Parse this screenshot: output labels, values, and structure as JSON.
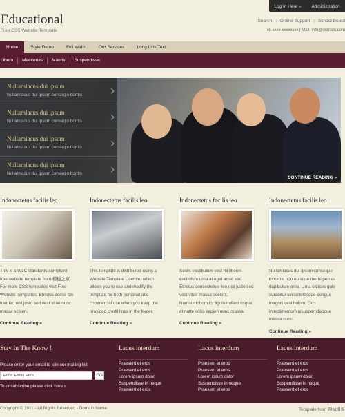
{
  "topbar": {
    "login": "Log In Here »",
    "admin": "Administration"
  },
  "header": {
    "title": "Educational",
    "subtitle": "Free CSS Website Template",
    "links": [
      "Search",
      "Online Support",
      "School Board"
    ],
    "contact": "Tel: xxxx xxxxxxxx | Mail: info@domain.com"
  },
  "nav": {
    "items": [
      "Home",
      "Style Demo",
      "Full Width",
      "Our Services",
      "Long Link Text"
    ]
  },
  "subnav": {
    "items": [
      "Libero",
      "Maecenas",
      "Mauris",
      "Suspendisse"
    ]
  },
  "banner": {
    "slides": [
      {
        "title": "Nullamlacus dui ipsum",
        "text": "Nullamlacus dui ipsum conseqlo borttis"
      },
      {
        "title": "Nullamlacus dui ipsum",
        "text": "Nullamlacus dui ipsum conseqlo borttis"
      },
      {
        "title": "Nullamlacus dui ipsum",
        "text": "Nullamlacus dui ipsum conseqlo borttis"
      },
      {
        "title": "Nullamlacus dui ipsum",
        "text": "Nullamlacus dui ipsum conseqlo borttis"
      }
    ],
    "continue": "CONTINUE READING »"
  },
  "columns": [
    {
      "heading": "Indonectetus facilis leo",
      "text": "This is a W3C standards compliant free website template from 模板之家. For more CSS templates visit Free Website Templates. Etnetus conse cte tuer leo nisl justo sed vest vitae nunc massa sceleri.",
      "more": "Continue Reading »"
    },
    {
      "heading": "Indonectetus facilis leo",
      "text": "This template is distributed using a Website Template Licence, which allows you to use and modify the template for both personal and commercial use when you keep the provided credit links in the footer.",
      "more": "Continue Reading »"
    },
    {
      "heading": "Indonectetus facilis leo",
      "text": "Sociis vestibulum vest mi liberos estibulum urna at eget amet sed. Etnetus consectetuer leo nisl justo sed vest vitae massa scelerit. Namauctobum lor ligula nullam risque at natte sollis sapien nunc massa.",
      "more": "Continue Reading »"
    },
    {
      "heading": "Indonectetus facilis leo",
      "text": "Nullamlacus dui ipsum conseque loborttis non euisque morbi pen as dapibulum orna. Urna ultrices quis curabitur siniselletesque congue magnis vestibulum. Orci interdimentum nisusperndaoque massa nunc.",
      "more": "Continue Reading »"
    }
  ],
  "footer": {
    "stay": {
      "heading": "Stay In The Know !",
      "text": "Please enter your email to join our mailing list",
      "placeholder": "Enter Email Here…",
      "go": "GO",
      "unsub": "To unsubscribe please click here »"
    },
    "lists": [
      {
        "heading": "Lacus interdum",
        "items": [
          "Praesent et eros",
          "Praesent et eros",
          "Lorem ipsum dolor",
          "Suspendisse in neque",
          "Praesent et eros"
        ]
      },
      {
        "heading": "Lacus interdum",
        "items": [
          "Praesent et eros",
          "Praesent et eros",
          "Lorem ipsum dolor",
          "Suspendisse in neque",
          "Praesent et eros"
        ]
      },
      {
        "heading": "Lacus interdum",
        "items": [
          "Praesent et eros",
          "Praesent et eros",
          "Lorem ipsum dolor",
          "Suspendisse in neque",
          "Praesent et eros"
        ]
      }
    ]
  },
  "bottom": {
    "copyright": "Copyright © 2011 - All Rights Reserved - Domain Name",
    "template": "Template from 网站模板"
  }
}
